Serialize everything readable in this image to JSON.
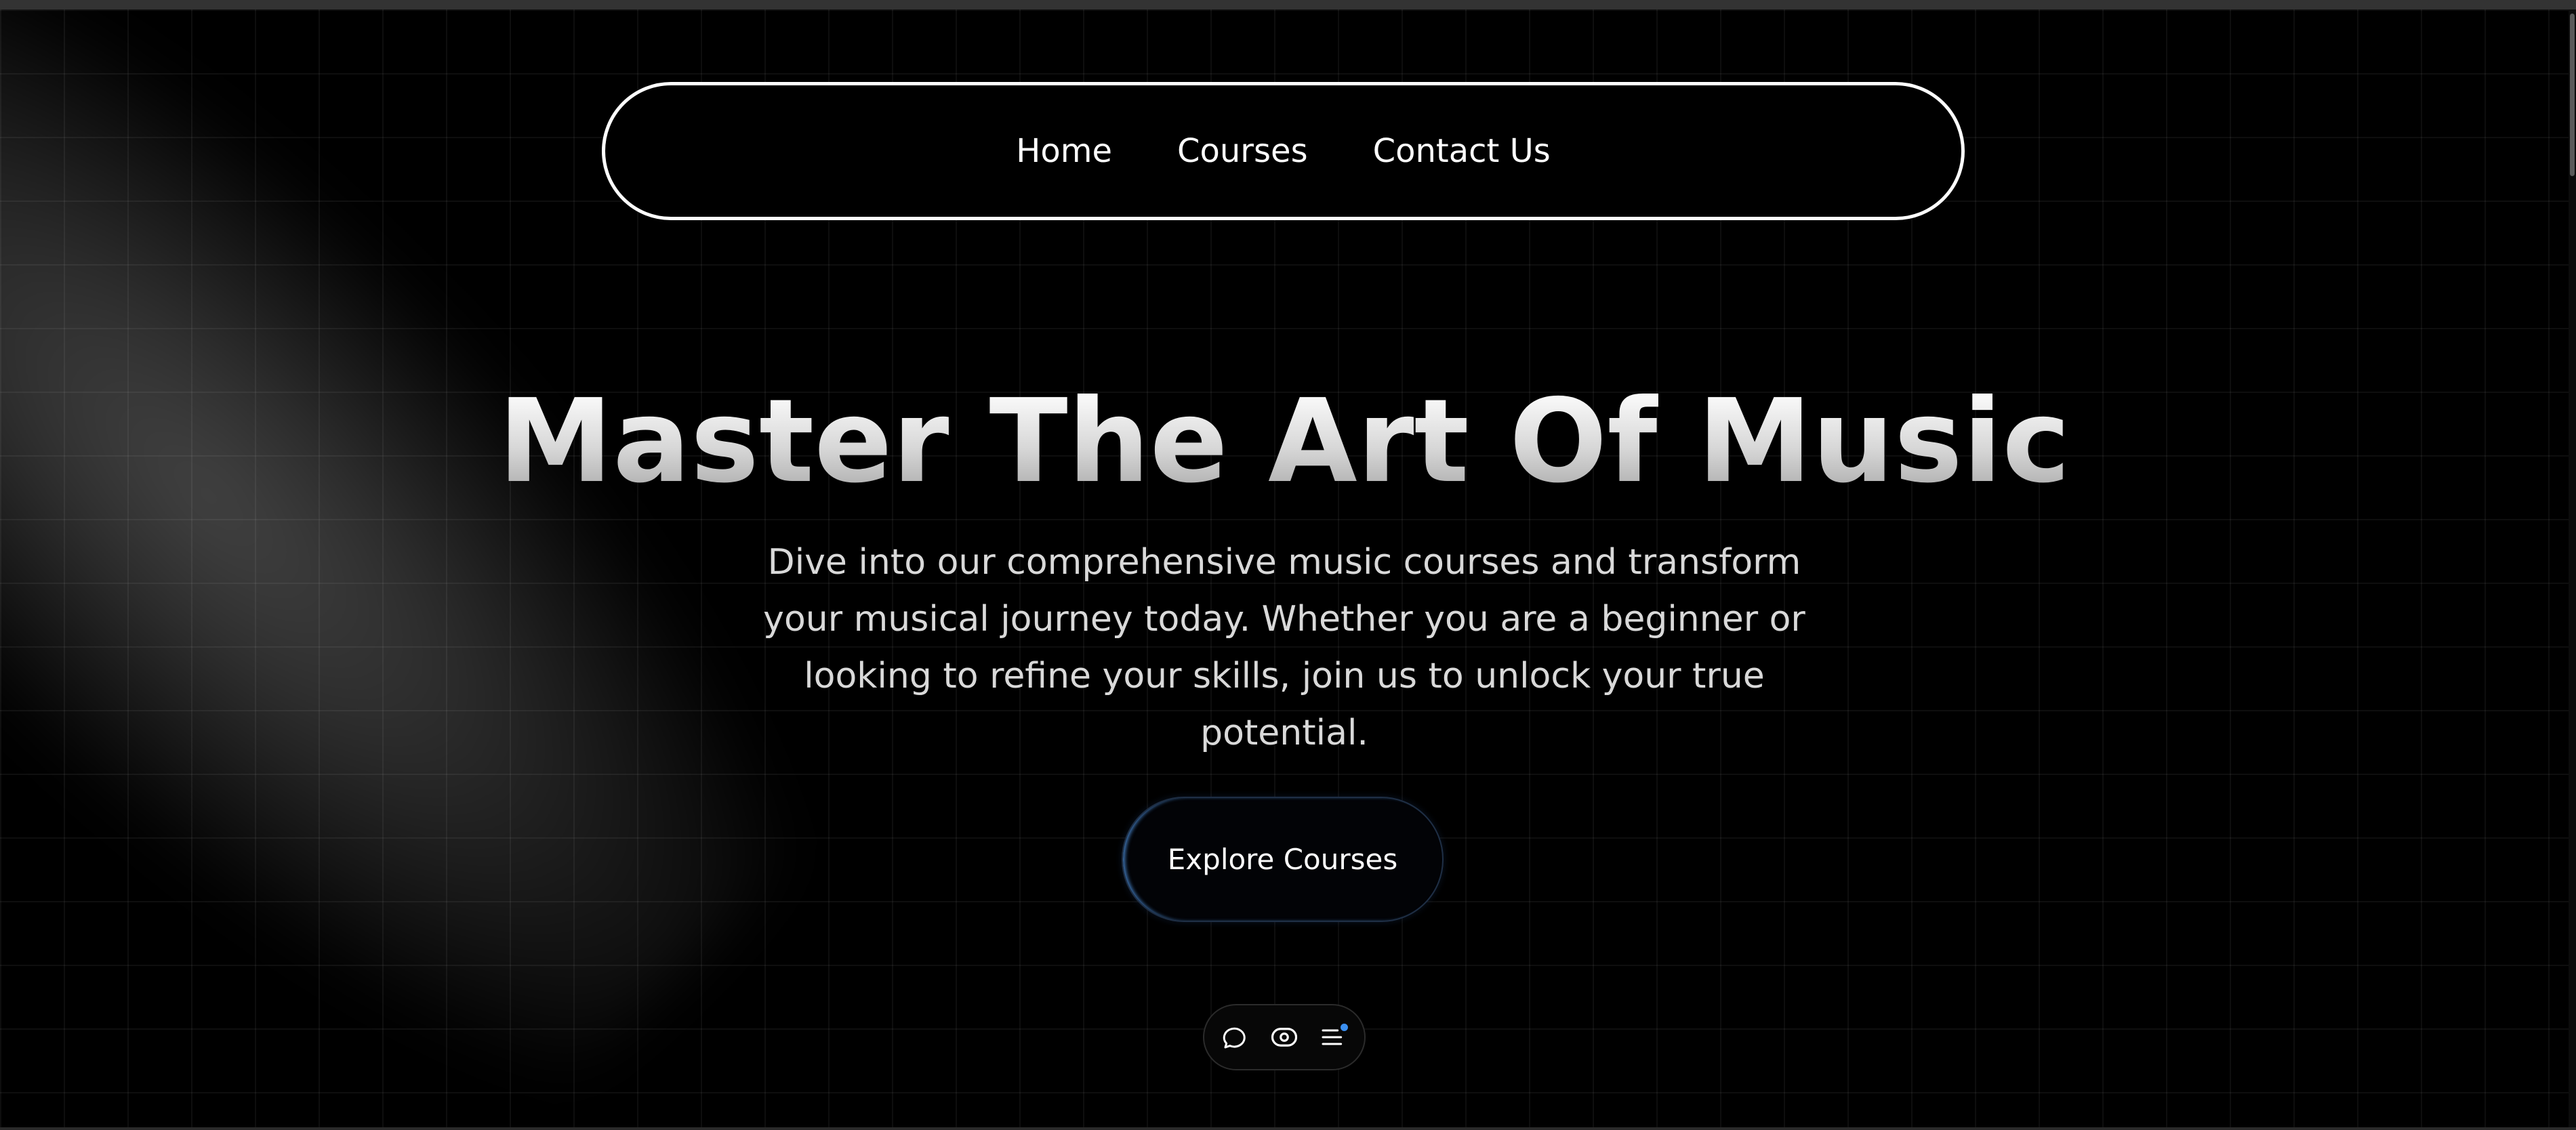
{
  "nav": {
    "items": [
      {
        "label": "Home"
      },
      {
        "label": "Courses"
      },
      {
        "label": "Contact Us"
      }
    ]
  },
  "hero": {
    "title": "Master The Art Of Music",
    "description": "Dive into our comprehensive music courses and transform your musical journey today. Whether you are a beginner or looking to refine your skills, join us to unlock your true potential.",
    "cta_label": "Explore Courses"
  },
  "toolbar": {
    "icons": [
      "chat-bubble-icon",
      "eye-toggle-icon",
      "menu-list-icon"
    ],
    "notification_color": "#3b8ff0"
  },
  "colors": {
    "background": "#000000",
    "nav_border": "#ffffff",
    "cta_accent": "#5096e6"
  }
}
